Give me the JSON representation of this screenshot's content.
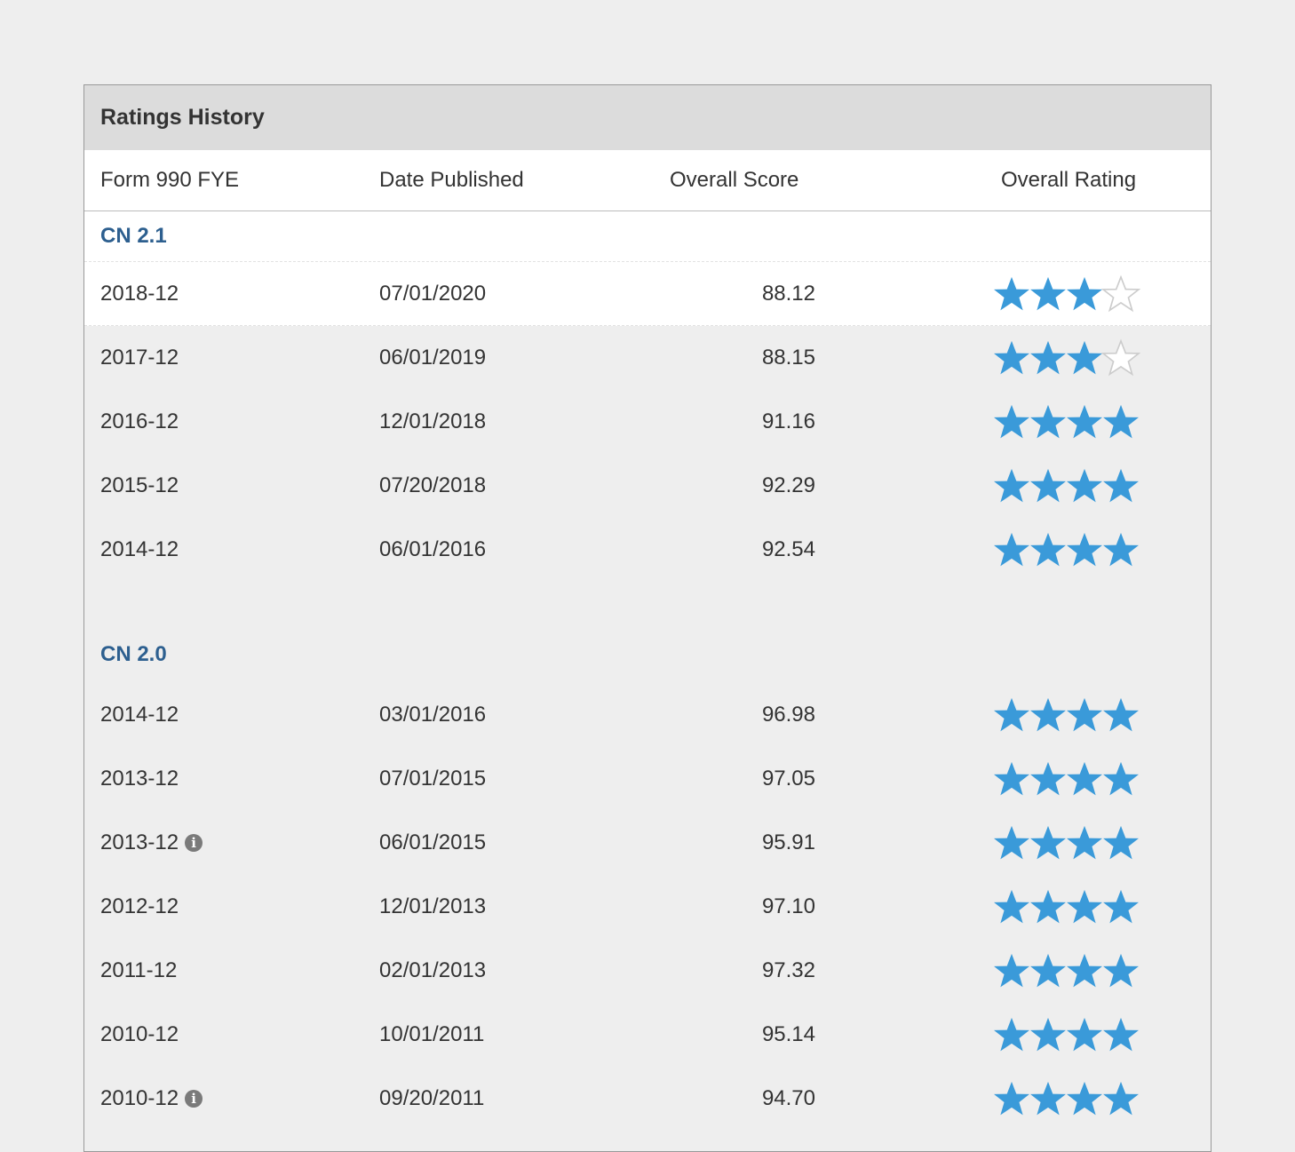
{
  "panel": {
    "title": "Ratings History"
  },
  "columns": {
    "fye": "Form 990 FYE",
    "date": "Date Published",
    "score": "Overall Score",
    "rating": "Overall Rating"
  },
  "colors": {
    "star_filled": "#3a9ad9",
    "star_empty_outline": "#cccccc",
    "section_label": "#2d5f8f"
  },
  "sections": [
    {
      "label": "CN 2.1",
      "rows": [
        {
          "fye": "2018-12",
          "date": "07/01/2020",
          "score": "88.12",
          "stars": 3,
          "max_stars": 4,
          "info": false,
          "highlight": true
        },
        {
          "fye": "2017-12",
          "date": "06/01/2019",
          "score": "88.15",
          "stars": 3,
          "max_stars": 4,
          "info": false
        },
        {
          "fye": "2016-12",
          "date": "12/01/2018",
          "score": "91.16",
          "stars": 4,
          "max_stars": 4,
          "info": false
        },
        {
          "fye": "2015-12",
          "date": "07/20/2018",
          "score": "92.29",
          "stars": 4,
          "max_stars": 4,
          "info": false
        },
        {
          "fye": "2014-12",
          "date": "06/01/2016",
          "score": "92.54",
          "stars": 4,
          "max_stars": 4,
          "info": false
        }
      ]
    },
    {
      "label": "CN 2.0",
      "rows": [
        {
          "fye": "2014-12",
          "date": "03/01/2016",
          "score": "96.98",
          "stars": 4,
          "max_stars": 4,
          "info": false
        },
        {
          "fye": "2013-12",
          "date": "07/01/2015",
          "score": "97.05",
          "stars": 4,
          "max_stars": 4,
          "info": false
        },
        {
          "fye": "2013-12",
          "date": "06/01/2015",
          "score": "95.91",
          "stars": 4,
          "max_stars": 4,
          "info": true
        },
        {
          "fye": "2012-12",
          "date": "12/01/2013",
          "score": "97.10",
          "stars": 4,
          "max_stars": 4,
          "info": false
        },
        {
          "fye": "2011-12",
          "date": "02/01/2013",
          "score": "97.32",
          "stars": 4,
          "max_stars": 4,
          "info": false
        },
        {
          "fye": "2010-12",
          "date": "10/01/2011",
          "score": "95.14",
          "stars": 4,
          "max_stars": 4,
          "info": false
        },
        {
          "fye": "2010-12",
          "date": "09/20/2011",
          "score": "94.70",
          "stars": 4,
          "max_stars": 4,
          "info": true
        }
      ]
    }
  ]
}
